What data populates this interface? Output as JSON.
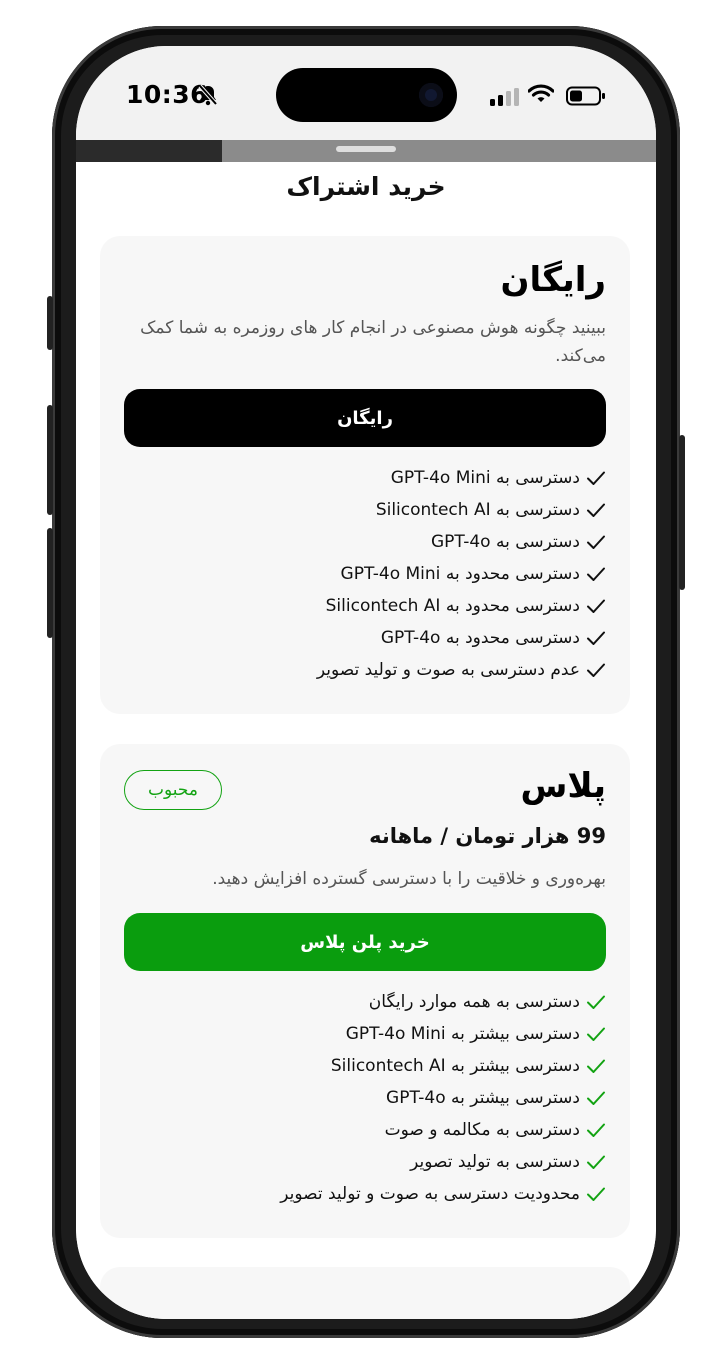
{
  "status_bar": {
    "time": "10:36"
  },
  "sheet": {
    "title": "خرید اشتراک"
  },
  "plans": [
    {
      "name": "رایگان",
      "description": "ببینید چگونه هوش مصنوعی در انجام کار های روزمره به شما کمک می‌کند.",
      "button_label": "رایگان",
      "features": [
        "دسترسی به GPT-4o Mini",
        "دسترسی به Silicontech AI",
        "دسترسی به GPT-4o",
        " دسترسی محدود به GPT-4o Mini",
        "دسترسی محدود به Silicontech AI",
        "دسترسی محدود به GPT-4o",
        "عدم دسترسی به صوت و تولید تصویر"
      ]
    },
    {
      "name": "پلاس",
      "badge": "محبوب",
      "price": "99 هزار تومان / ماهانه",
      "description": "بهره‌وری و خلاقیت را با دسترسی گسترده افزایش دهید.",
      "button_label": "خرید پلن پلاس",
      "features": [
        "دسترسی به همه موارد رایگان",
        "دسترسی بیشتر به GPT-4o Mini",
        "دسترسی بیشتر به Silicontech AI",
        "دسترسی بیشتر به GPT-4o",
        "دسترسی به مکالمه و صوت",
        "دسترسی به تولید تصویر",
        "محدودیت دسترسی به صوت و تولید تصویر"
      ]
    }
  ],
  "colors": {
    "primary_button": "#000000",
    "accent_green": "#0a9d0e",
    "check_black": "#111111",
    "check_green": "#13a313",
    "card_background": "#f7f7f7"
  },
  "icons": {
    "feature_check": "check-icon",
    "status_bell": "bell-slash-icon",
    "status_signal": "cellular-signal-icon",
    "status_wifi": "wifi-icon",
    "status_battery": "battery-icon"
  }
}
